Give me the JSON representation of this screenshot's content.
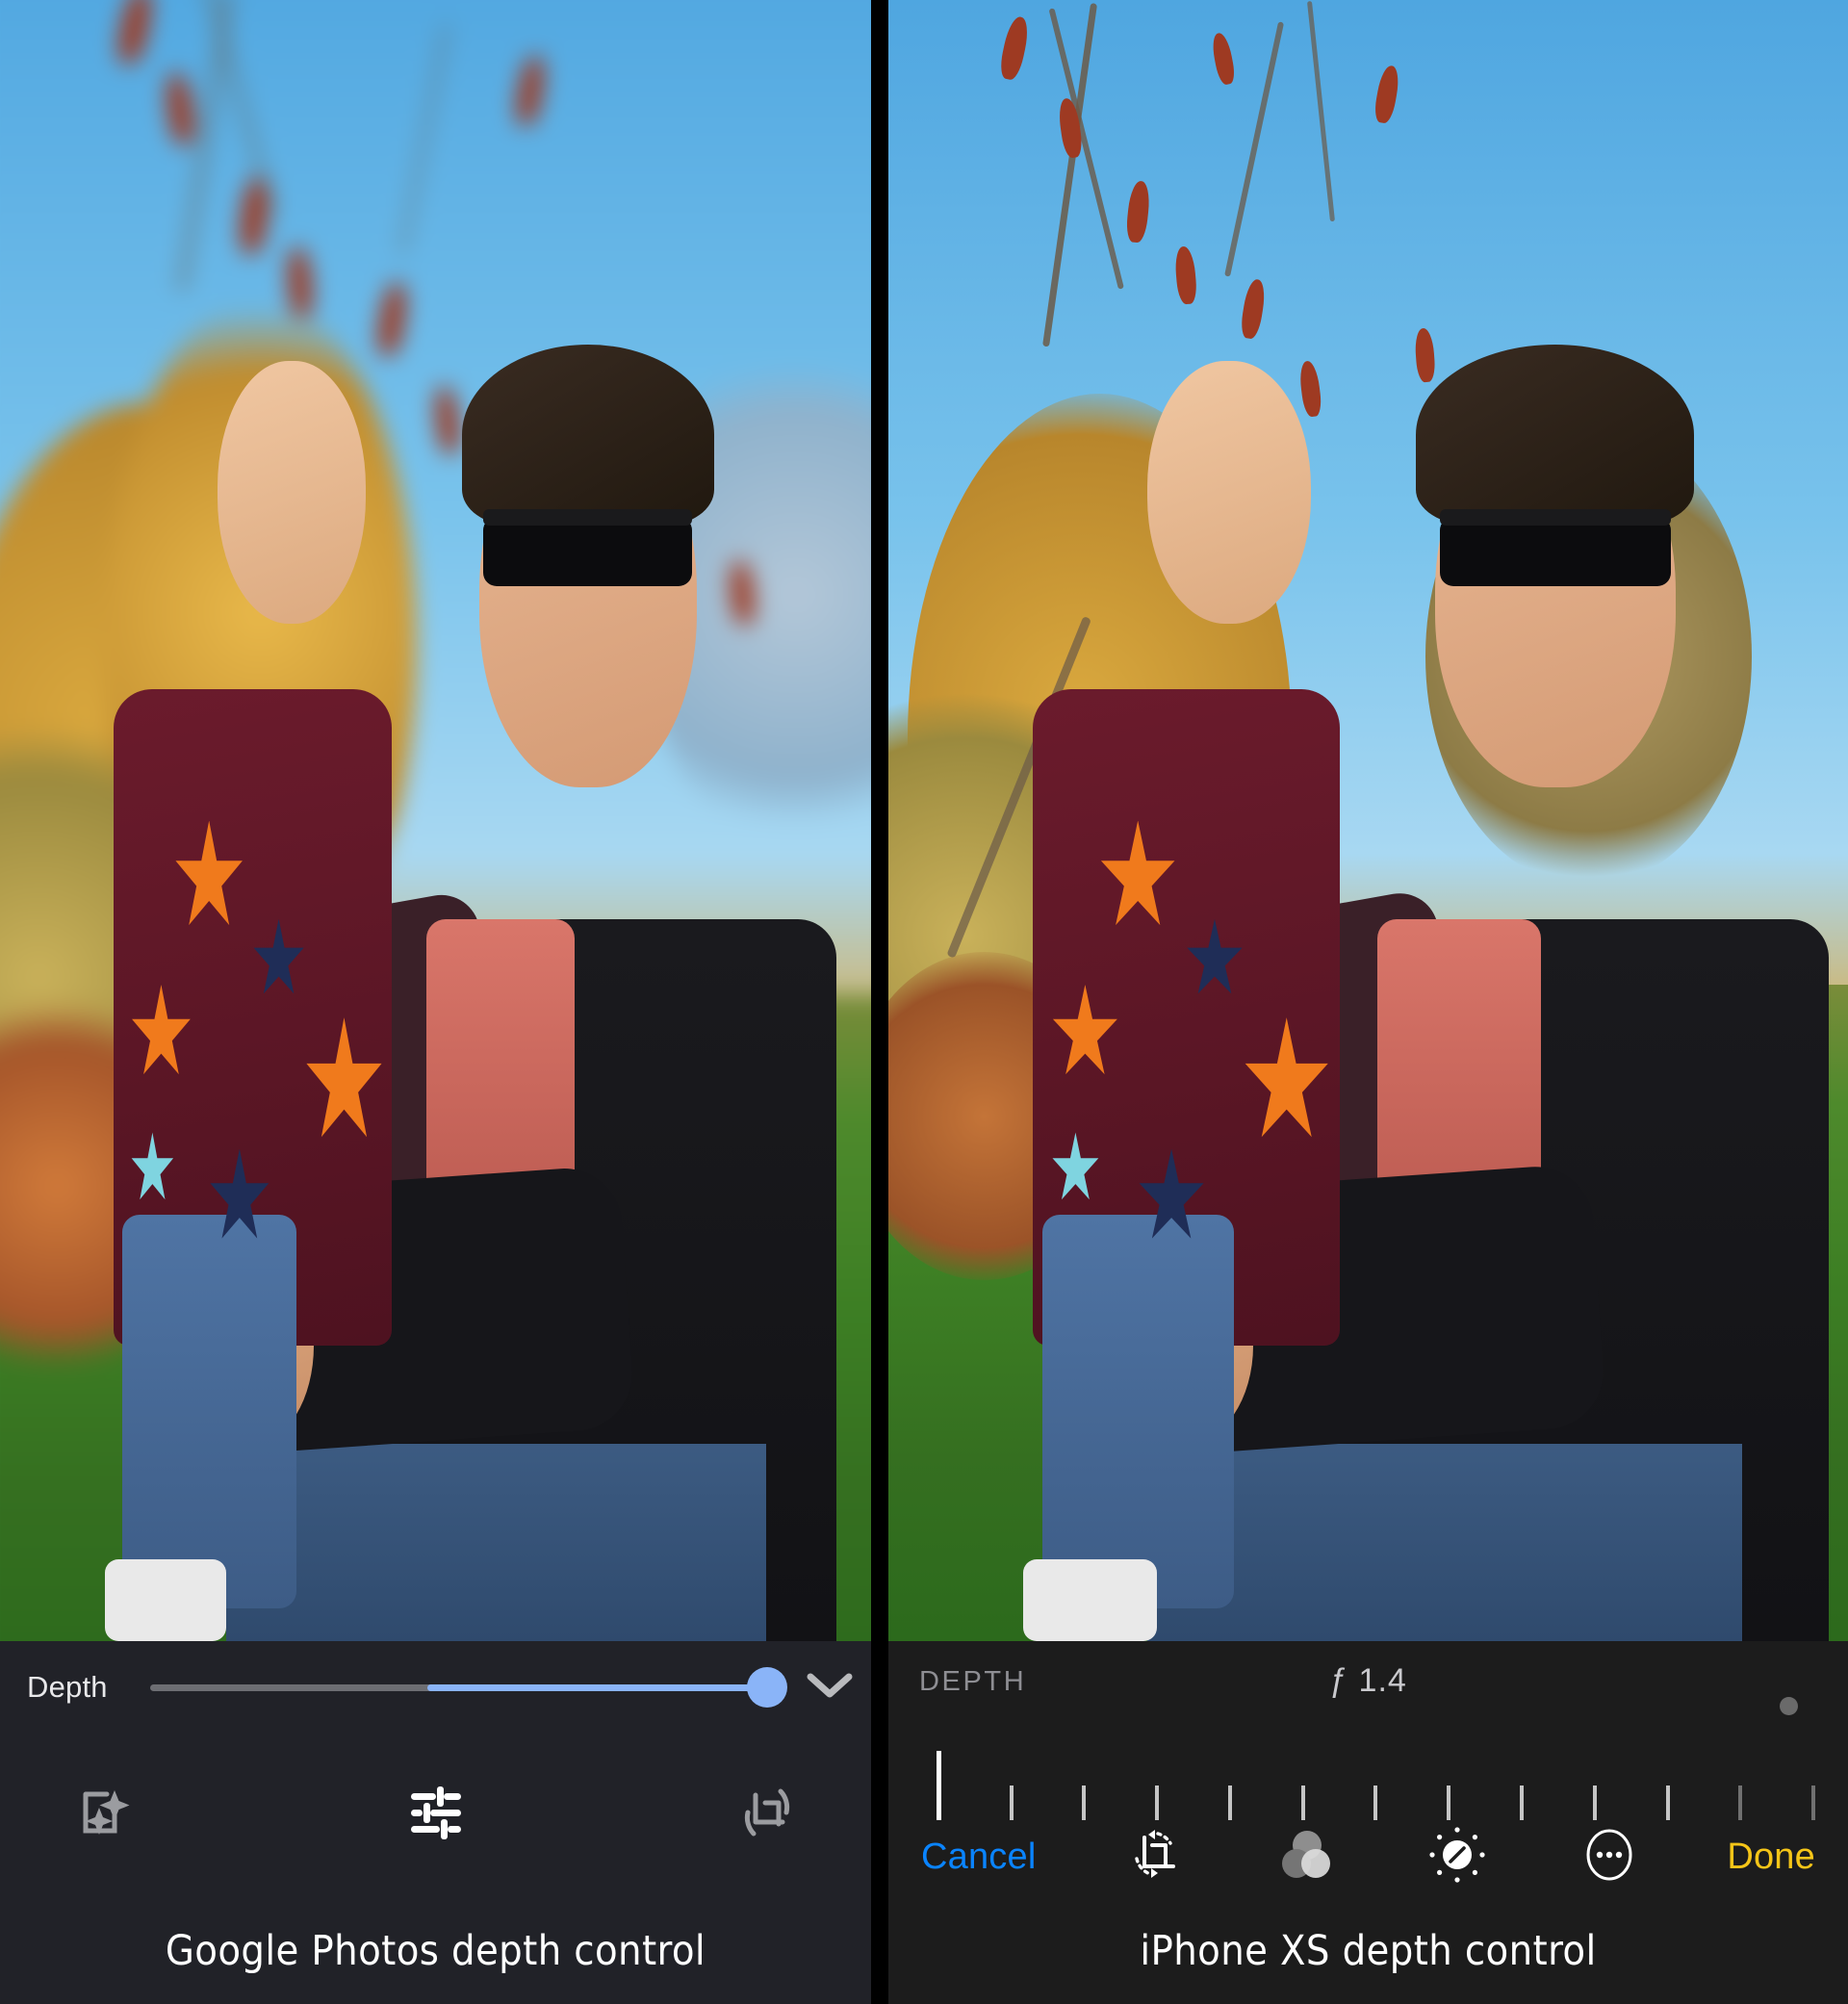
{
  "comparison": {
    "left": {
      "caption": "Google Photos depth control",
      "app": "Google Photos",
      "controls": {
        "slider_label": "Depth",
        "slider_value_percent": 100,
        "slider_fill_start_percent": 45,
        "collapse_icon": "chevron-down-icon",
        "tools": [
          {
            "name": "auto-enhance-icon",
            "label": "Auto enhance",
            "active": false
          },
          {
            "name": "tune-sliders-icon",
            "label": "Adjust",
            "active": true
          },
          {
            "name": "crop-rotate-icon",
            "label": "Crop & rotate",
            "active": false
          }
        ]
      },
      "photo": {
        "description": "Man wearing black sunglasses and black jacket holding a smiling young girl in a maroon star-print hoodie, autumn park background",
        "background_blur": "strong"
      }
    },
    "right": {
      "caption": "iPhone XS depth control",
      "app": "iPhone XS Photos",
      "controls": {
        "mode_label": "DEPTH",
        "aperture_value": "ƒ 1.4",
        "aperture_number": 1.4,
        "ruler_tick_count": 12,
        "cursor_position_percent": 5,
        "tools": [
          {
            "name": "cancel-button",
            "label": "Cancel",
            "color": "#0a84ff"
          },
          {
            "name": "crop-rotate-icon",
            "label": "Crop",
            "active": false
          },
          {
            "name": "filters-icon",
            "label": "Filters",
            "active": false
          },
          {
            "name": "adjust-dial-icon",
            "label": "Adjust",
            "active": true
          },
          {
            "name": "more-options-icon",
            "label": "More",
            "active": false
          },
          {
            "name": "done-button",
            "label": "Done",
            "color": "#f5c518"
          }
        ]
      },
      "photo": {
        "description": "Same man and girl, background only mildly blurred showing bare tree branches with red buds",
        "background_blur": "mild"
      }
    }
  },
  "colors": {
    "panel_bg_left": "#212228",
    "panel_bg_right": "#1c1c1c",
    "accent_blue": "#8ab4f8",
    "ios_blue": "#0a84ff",
    "ios_yellow": "#f5c518",
    "track_gray": "#6d6e73",
    "label_gray": "#8e8e93"
  }
}
